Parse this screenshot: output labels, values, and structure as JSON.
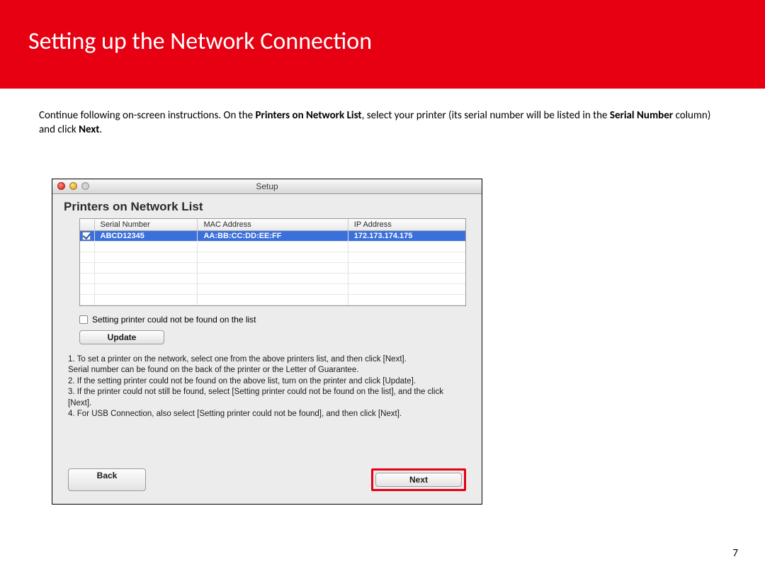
{
  "header": {
    "title": "Setting up the Network Connection"
  },
  "instruction": {
    "pre": "Continue following on-screen instructions.  On the ",
    "bold1": "Printers on Network List",
    "mid": ", select your printer (its serial number will be listed in the ",
    "bold2": "Serial Number",
    "mid2": " column) and click ",
    "bold3": "Next",
    "post": "."
  },
  "window": {
    "title": "Setup",
    "panel_title": "Printers on Network List",
    "columns": {
      "serial": "Serial Number",
      "mac": "MAC Address",
      "ip": "IP Address"
    },
    "row": {
      "serial": "ABCD12345",
      "mac": "AA:BB:CC:DD:EE:FF",
      "ip": "172.173.174.175"
    },
    "notfound_label": "Setting printer could not be found on the list",
    "update_label": "Update",
    "notes": {
      "l1": "1. To set a printer on the network, select one from the above printers list, and then click [Next].",
      "l2": "Serial number can be found on the back of the printer or the Letter of Guarantee.",
      "l3": "2. If the setting printer could not be found on the above list, turn on the printer and click [Update].",
      "l4": "3. If the printer could not still be found, select [Setting printer could not be found on the list], and the click",
      "l5": "[Next].",
      "l6": "4. For USB Connection, also select [Setting printer could not be found], and then click [Next]."
    },
    "back_label": "Back",
    "next_label": "Next"
  },
  "page_number": "7"
}
